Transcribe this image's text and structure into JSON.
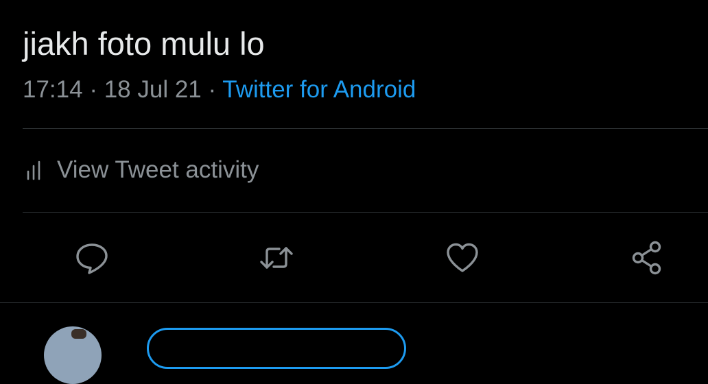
{
  "tweet": {
    "text": "jiakh foto mulu lo",
    "time": "17:14",
    "separator": "·",
    "date": "18 Jul 21",
    "source": "Twitter for Android"
  },
  "activity": {
    "icon": "bar-chart-icon",
    "label": "View Tweet activity"
  },
  "actions": [
    {
      "name": "reply",
      "icon": "reply-icon"
    },
    {
      "name": "retweet",
      "icon": "retweet-icon"
    },
    {
      "name": "like",
      "icon": "heart-icon"
    },
    {
      "name": "share",
      "icon": "share-icon"
    }
  ],
  "colors": {
    "background": "#000000",
    "text": "#e7e9ea",
    "secondary": "#8b9196",
    "accent": "#1d9bf0",
    "divider": "#2f3336"
  }
}
